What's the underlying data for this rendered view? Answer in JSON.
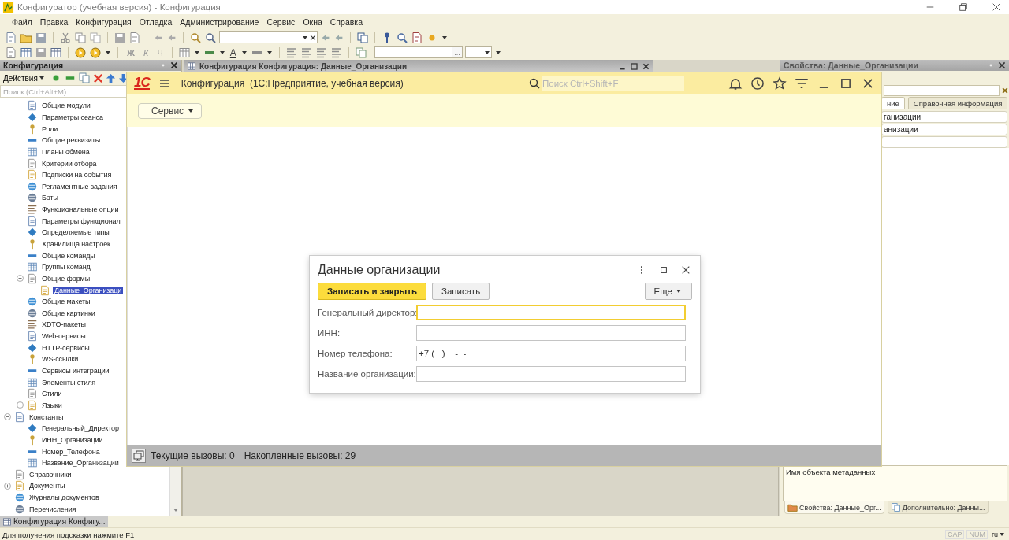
{
  "window": {
    "title": "Конфигуратор (учебная версия) - Конфигурация"
  },
  "menu": [
    "Файл",
    "Правка",
    "Конфигурация",
    "Отладка",
    "Администрирование",
    "Сервис",
    "Окна",
    "Справка"
  ],
  "toolbar": {
    "format_buttons": [
      "Ж",
      "К",
      "Ч"
    ],
    "font_color_button": "A",
    "ellipsis_button": "..."
  },
  "config_panel": {
    "title": "Конфигурация",
    "actions_button": "Действия",
    "search": {
      "placeholder": "Поиск (Ctrl+Alt+M)"
    },
    "tree": {
      "continued_items": [
        {
          "label": "Общие модули",
          "selected": false
        },
        {
          "label": "Параметры сеанса",
          "selected": false
        },
        {
          "label": "Роли",
          "selected": false
        },
        {
          "label": "Общие реквизиты",
          "selected": false
        },
        {
          "label": "Планы обмена",
          "selected": false
        },
        {
          "label": "Критерии отбора",
          "selected": false
        },
        {
          "label": "Подписки на события",
          "selected": false
        },
        {
          "label": "Регламентные задания",
          "selected": false
        },
        {
          "label": "Боты",
          "selected": false
        },
        {
          "label": "Функциональные опции",
          "selected": false
        },
        {
          "label": "Параметры функционал",
          "selected": false
        },
        {
          "label": "Определяемые типы",
          "selected": false
        },
        {
          "label": "Хранилища настроек",
          "selected": false
        },
        {
          "label": "Общие команды",
          "selected": false
        },
        {
          "label": "Группы команд",
          "selected": false
        },
        {
          "label": "Общие формы",
          "selected": false,
          "expanded": true,
          "children": [
            {
              "label": "Данные_Организаци",
              "selected": true
            }
          ]
        },
        {
          "label": "Общие макеты",
          "selected": false
        },
        {
          "label": "Общие картинки",
          "selected": false
        },
        {
          "label": "XDTO-пакеты",
          "selected": false
        },
        {
          "label": "Web-сервисы",
          "selected": false
        },
        {
          "label": "HTTP-сервисы",
          "selected": false
        },
        {
          "label": "WS-ссылки",
          "selected": false
        },
        {
          "label": "Сервисы интеграции",
          "selected": false
        },
        {
          "label": "Элементы стиля",
          "selected": false
        },
        {
          "label": "Стили",
          "selected": false
        },
        {
          "label": "Языки",
          "selected": false,
          "expanded": false
        }
      ],
      "items": [
        {
          "label": "Константы",
          "selected": false,
          "expanded": true,
          "children": [
            {
              "label": "Генеральный_Директор",
              "selected": false
            },
            {
              "label": "ИНН_Организации",
              "selected": false
            },
            {
              "label": "Номер_Телефона",
              "selected": false
            },
            {
              "label": "Название_Организации",
              "selected": false
            }
          ]
        },
        {
          "label": "Справочники",
          "selected": false
        },
        {
          "label": "Документы",
          "selected": false,
          "expanded": false
        },
        {
          "label": "Журналы документов",
          "selected": false
        },
        {
          "label": "Перечисления",
          "selected": false
        }
      ]
    }
  },
  "editor_window": {
    "title": "Конфигурация Конфигурация: Данные_Организации"
  },
  "enterprise_window": {
    "logo": "1С",
    "title": "Конфигурация  (1С:Предприятие, учебная версия)",
    "search": {
      "placeholder": "Поиск Ctrl+Shift+F"
    },
    "service_button": "Сервис",
    "status": [
      "Текущие вызовы: 0",
      "Накопленные вызовы: 29"
    ]
  },
  "dialog": {
    "title": "Данные организации",
    "buttons": [
      {
        "label": "Записать и закрыть",
        "kind": "primary"
      },
      {
        "label": "Записать",
        "kind": "default"
      }
    ],
    "more_button": "Еще",
    "fields": [
      {
        "label": "Генеральный директор:",
        "focused": true
      },
      {
        "label": "ИНН:",
        "focused": false
      },
      {
        "label": "Номер телефона:",
        "value": "+7 (   )    -  -",
        "focused": false
      },
      {
        "label": "Название организации:",
        "focused": false
      }
    ]
  },
  "properties_panel": {
    "title": "Свойства: Данные_Организации",
    "tabs": [
      {
        "label": "ние",
        "selected": true
      },
      {
        "label": "Справочная информация",
        "selected": false
      }
    ],
    "rows": [
      {
        "value": "ганизации"
      },
      {
        "value": "анизации"
      },
      {}
    ],
    "description": "Имя объекта метаданных",
    "bottom_tabs": [
      {
        "label": "Свойства: Данные_Орг...",
        "selected": true
      },
      {
        "label": "Дополнительно: Данны...",
        "selected": false
      }
    ]
  },
  "taskbar": [
    {
      "label": "Конфигурация Конфигу...",
      "selected": true
    }
  ],
  "status_bar": {
    "hint": "Для получения подсказки нажмите F1",
    "indicators": [
      "CAP",
      "NUM"
    ],
    "language": "ru"
  }
}
